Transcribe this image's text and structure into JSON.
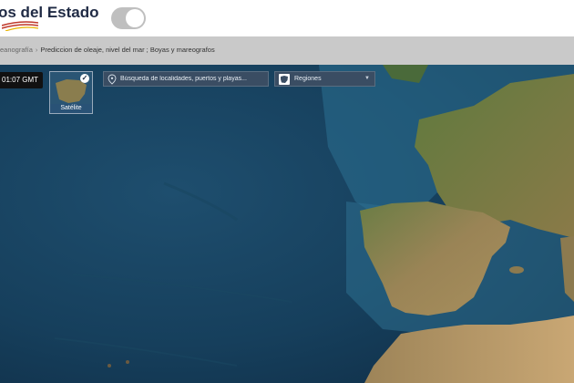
{
  "header": {
    "brand": "os del Estado"
  },
  "breadcrumb": {
    "prefix": "eanografía",
    "current": "Prediccion de oleaje, nivel del mar ; Boyas y mareografos"
  },
  "map": {
    "time": "01:07 GMT",
    "layer_label": "Satélite",
    "search_placeholder": "Búsqueda de localidades, puertos y playas...",
    "region_label": "Regiones"
  }
}
